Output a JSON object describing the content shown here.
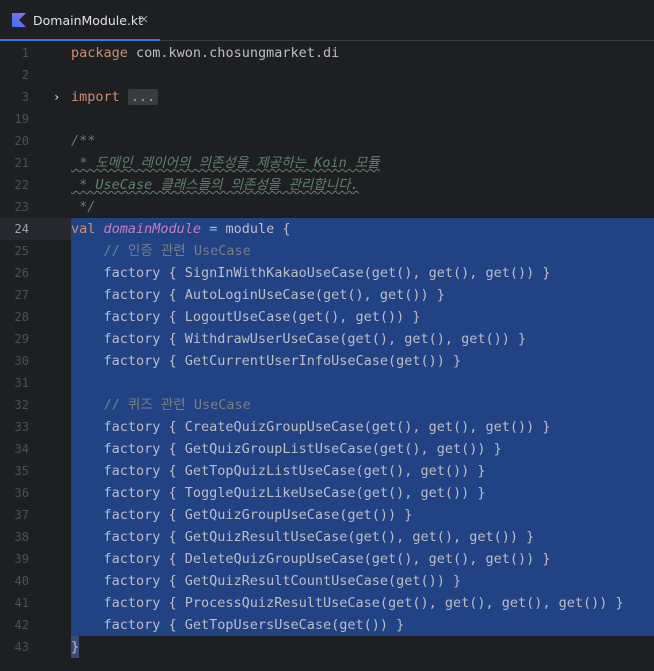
{
  "tab": {
    "filename": "DomainModule.kt",
    "close_glyph": "×",
    "icon": "kotlin-icon"
  },
  "colors": {
    "accent": "#3574f0",
    "selection": "#214283",
    "keyword": "#cf8e6d",
    "function": "#c77dbb",
    "comment": "#7a7e85",
    "doc": "#5f826b"
  },
  "editor": {
    "current_line": "24",
    "fold_arrow": "›",
    "lines": {
      "l1": {
        "n": "1",
        "kw": "package",
        "text": " com.kwon.chosungmarket.di"
      },
      "l2": {
        "n": "2"
      },
      "l3": {
        "n": "3",
        "kw": "import",
        "fold": "..."
      },
      "l19": {
        "n": "19"
      },
      "l20": {
        "n": "20",
        "doc": "/**"
      },
      "l21": {
        "n": "21",
        "doc": " * 도메인 레이어의 의존성을 제공하는 Koin 모듈"
      },
      "l22": {
        "n": "22",
        "doc": " * UseCase 클래스들의 의존성을 관리합니다."
      },
      "l23": {
        "n": "23",
        "doc": " */"
      },
      "l24": {
        "n": "24",
        "kw": "val",
        "name": "domainModule",
        "text": " = module {"
      },
      "l25": {
        "n": "25",
        "comment": "    // 인증 관련 UseCase"
      },
      "l26": {
        "n": "26",
        "text": "    factory { SignInWithKakaoUseCase(get(), get(), get()) }"
      },
      "l27": {
        "n": "27",
        "text": "    factory { AutoLoginUseCase(get(), get()) }"
      },
      "l28": {
        "n": "28",
        "text": "    factory { LogoutUseCase(get(), get()) }"
      },
      "l29": {
        "n": "29",
        "text": "    factory { WithdrawUserUseCase(get(), get(), get()) }"
      },
      "l30": {
        "n": "30",
        "text": "    factory { GetCurrentUserInfoUseCase(get()) }"
      },
      "l31": {
        "n": "31"
      },
      "l32": {
        "n": "32",
        "comment": "    // 퀴즈 관련 UseCase"
      },
      "l33": {
        "n": "33",
        "text": "    factory { CreateQuizGroupUseCase(get(), get(), get()) }"
      },
      "l34": {
        "n": "34",
        "text": "    factory { GetQuizGroupListUseCase(get(), get()) }"
      },
      "l35": {
        "n": "35",
        "text": "    factory { GetTopQuizListUseCase(get(), get()) }"
      },
      "l36": {
        "n": "36",
        "text": "    factory { ToggleQuizLikeUseCase(get(), get()) }"
      },
      "l37": {
        "n": "37",
        "text": "    factory { GetQuizGroupUseCase(get()) }"
      },
      "l38": {
        "n": "38",
        "text": "    factory { GetQuizResultUseCase(get(), get(), get()) }"
      },
      "l39": {
        "n": "39",
        "text": "    factory { DeleteQuizGroupUseCase(get(), get(), get()) }"
      },
      "l40": {
        "n": "40",
        "text": "    factory { GetQuizResultCountUseCase(get()) }"
      },
      "l41": {
        "n": "41",
        "text": "    factory { ProcessQuizResultUseCase(get(), get(), get(), get()) }"
      },
      "l42": {
        "n": "42",
        "text": "    factory { GetTopUsersUseCase(get()) }"
      },
      "l43": {
        "n": "43",
        "text": "}"
      }
    }
  }
}
